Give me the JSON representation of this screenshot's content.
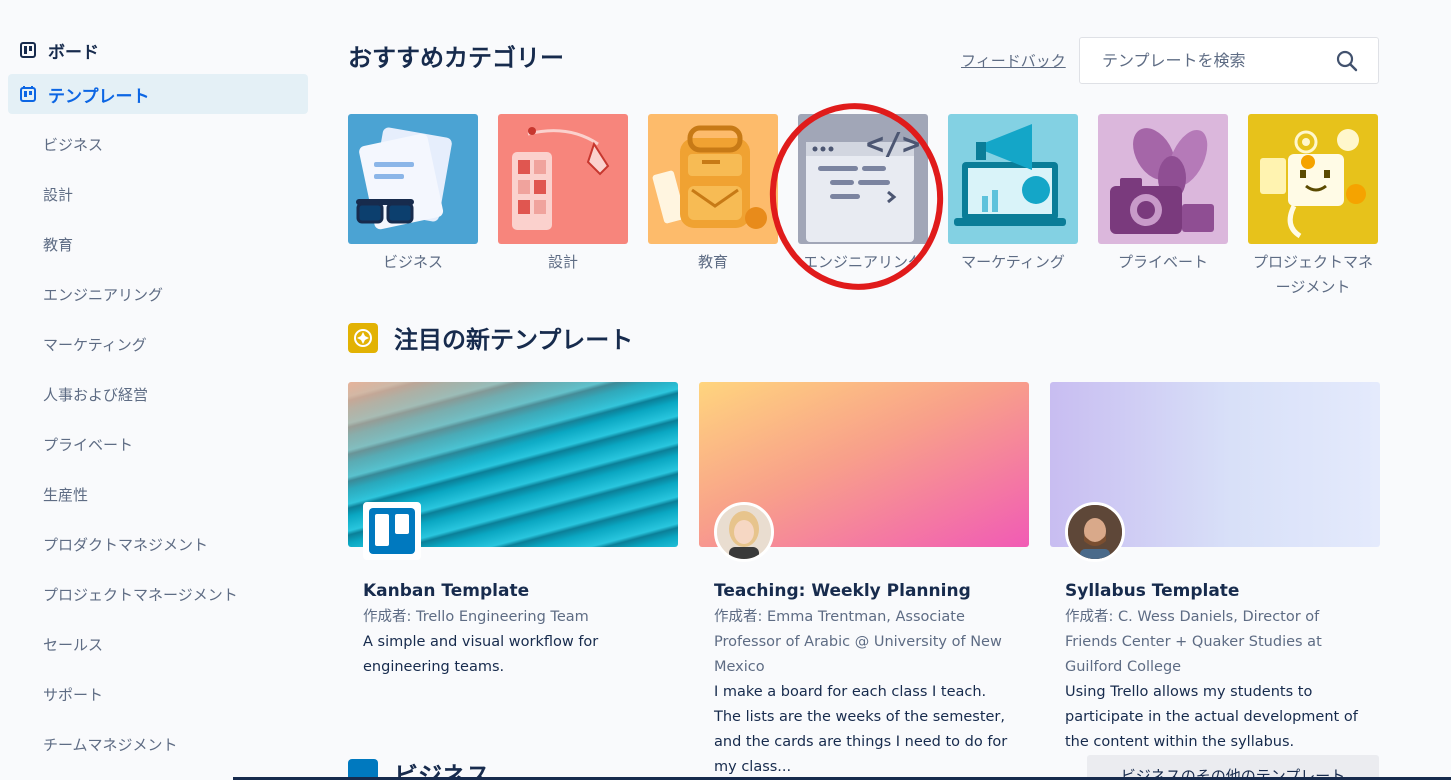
{
  "sidebar": {
    "boards_label": "ボード",
    "templates_label": "テンプレート",
    "items": [
      {
        "label": "ビジネス"
      },
      {
        "label": "設計"
      },
      {
        "label": "教育"
      },
      {
        "label": "エンジニアリング"
      },
      {
        "label": "マーケティング"
      },
      {
        "label": "人事および経営"
      },
      {
        "label": "プライベート"
      },
      {
        "label": "生産性"
      },
      {
        "label": "プロダクトマネジメント"
      },
      {
        "label": "プロジェクトマネージメント"
      },
      {
        "label": "セールス"
      },
      {
        "label": "サポート"
      },
      {
        "label": "チームマネジメント"
      }
    ]
  },
  "header": {
    "title": "おすすめカテゴリー",
    "feedback": "フィードバック",
    "search_placeholder": "テンプレートを検索"
  },
  "categories": [
    {
      "label": "ビジネス",
      "color": "#4ba3d3"
    },
    {
      "label": "設計",
      "color": "#f7857c"
    },
    {
      "label": "教育",
      "color": "#fdbb6b"
    },
    {
      "label": "エンジニアリング",
      "color": "#a1a6b7"
    },
    {
      "label": "マーケティング",
      "color": "#83d1e3"
    },
    {
      "label": "プライベート",
      "color": "#dbb7dc"
    },
    {
      "label": "プロジェクトマネージメント",
      "color": "#e7c21b"
    }
  ],
  "featured": {
    "title": "注目の新テンプレート",
    "cards": [
      {
        "title": "Kanban Template",
        "author": "作成者: Trello Engineering Team",
        "description": "A simple and visual workflow for engineering teams."
      },
      {
        "title": "Teaching: Weekly Planning",
        "author": "作成者: Emma Trentman, Associate Professor of Arabic @ University of New Mexico",
        "description": "I make a board for each class I teach. The lists are the weeks of the semester, and the cards are things I need to do for my class..."
      },
      {
        "title": "Syllabus Template",
        "author": "作成者: C. Wess Daniels, Director of Friends Center + Quaker Studies at Guilford College",
        "description": "Using Trello allows my students to participate in the actual development of the content within the syllabus."
      }
    ]
  },
  "business_section": {
    "title": "ビジネス",
    "more_button": "ビジネスのその他のテンプレート"
  },
  "colors": {
    "accent": "#0c66e4",
    "annotation": "#e01b1b"
  }
}
